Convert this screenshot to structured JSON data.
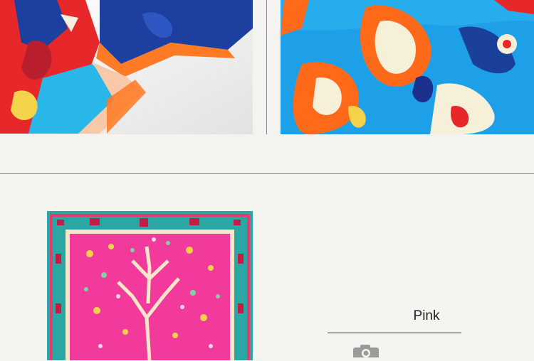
{
  "images": {
    "top_left": {
      "icon": "scarf-photo-closeup",
      "palette": [
        "#e8282b",
        "#1d3fa0",
        "#29b6e8",
        "#ff7a25"
      ]
    },
    "top_right": {
      "icon": "scarf-photo-pattern",
      "palette": [
        "#1ea0e8",
        "#ff6a1a",
        "#f7f0d8",
        "#1b2f8c"
      ]
    },
    "main_scarf": {
      "icon": "pink-tree-of-life-scarf",
      "palette": [
        "#f23a9c",
        "#2aa7a3",
        "#f4d24a",
        "#7fd3a6"
      ]
    }
  },
  "variant": {
    "label": "Pink"
  },
  "camera_icon": "camera-icon"
}
